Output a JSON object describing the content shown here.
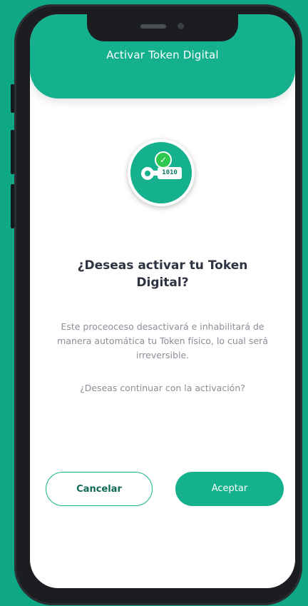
{
  "header": {
    "title": "Activar Token Digital"
  },
  "icon": {
    "name": "token-key-icon",
    "code_text": "1010",
    "badge": "check-icon"
  },
  "dialog": {
    "question": "¿Deseas activar tu Token Digital?",
    "description": "Este proceoceso desactivará e inhabilitará de manera automática tu Token físico, lo cual será irreversible.",
    "confirm": "¿Deseas continuar con la activación?"
  },
  "buttons": {
    "cancel_label": "Cancelar",
    "accept_label": "Aceptar"
  },
  "colors": {
    "brand": "#15b08d",
    "background": "#0fa886",
    "text_dark": "#2f3240",
    "text_muted": "#8a8f98",
    "success": "#2fc94f"
  }
}
